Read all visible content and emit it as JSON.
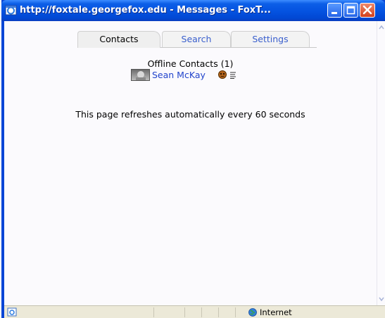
{
  "window": {
    "title": "http://foxtale.georgefox.edu - Messages - FoxT...",
    "icon": "ie-icon",
    "controls": [
      "minimize-icon",
      "maximize-icon",
      "close-icon"
    ]
  },
  "tabs": [
    {
      "label": "Contacts",
      "active": true
    },
    {
      "label": "Search",
      "active": false
    },
    {
      "label": "Settings",
      "active": false
    }
  ],
  "contacts": {
    "heading": "Offline Contacts (1)",
    "items": [
      {
        "name": "Sean McKay",
        "avatar": "avatar-photo",
        "status_icon": "offline-status-icon",
        "note_icon": "note-icon"
      }
    ]
  },
  "notice": "This page refreshes automatically every 60 seconds",
  "statusbar": {
    "zone": "Internet",
    "zone_icon": "globe-icon",
    "page_icon": "ie-page-icon"
  },
  "colors": {
    "titlebar": "#0452e0",
    "link": "#2244cc",
    "client_bg": "#fbfafd",
    "statusbar_bg": "#ece9d8"
  }
}
